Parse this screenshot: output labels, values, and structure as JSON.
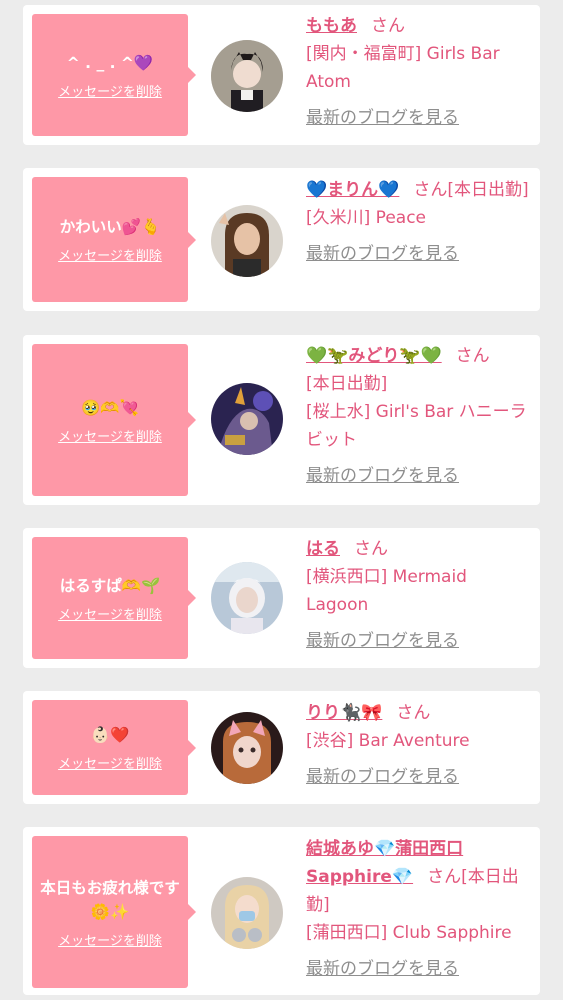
{
  "entries": [
    {
      "message": "^ . _ . ^💜",
      "delete_label": "メッセージを削除",
      "name": "ももあ",
      "honorific": "さん",
      "status": "",
      "shop": "[関内・福富町] Girls Bar Atom",
      "blog_link": "最新のブログを見る",
      "avatar": "avatar-photo-catgirl"
    },
    {
      "message": "かわいい💕🫰",
      "delete_label": "メッセージを削除",
      "name": "💙まりん💙",
      "honorific": "さん",
      "status": "[本日出勤]",
      "shop": "[久米川] Peace",
      "blog_link": "最新のブログを見る",
      "avatar": "avatar-photo-peace-sign"
    },
    {
      "message": "🥹🫶💘",
      "delete_label": "メッセージを削除",
      "name": "💚🦖みどり🦖💚",
      "honorific": "さん",
      "status": "[本日出勤]",
      "shop": "[桜上水] Girl's Bar ハニーラビット",
      "blog_link": "最新のブログを見る",
      "avatar": "avatar-photo-cosplay"
    },
    {
      "message": "はるすぱ🫶🌱",
      "delete_label": "メッセージを削除",
      "name": "はる",
      "honorific": "さん",
      "status": "",
      "shop": "[横浜西口] Mermaid Lagoon",
      "blog_link": "最新のブログを見る",
      "avatar": "avatar-photo-maid"
    },
    {
      "message": "👶🏻❤️",
      "delete_label": "メッセージを削除",
      "name": "りり🐈‍⬛🎀",
      "honorific": "さん",
      "status": "",
      "shop": "[渋谷] Bar Aventure",
      "blog_link": "最新のブログを見る",
      "avatar": "avatar-photo-cat-ears-filter"
    },
    {
      "message": "本日もお疲れ様です🌼✨",
      "delete_label": "メッセージを削除",
      "name": "結城あゆ💎蒲田西口Sapphire💎",
      "honorific": "さん",
      "status": "[本日出勤]",
      "shop": "[蒲田西口] Club Sapphire",
      "blog_link": "最新のブログを見る",
      "avatar": "avatar-photo-masked"
    }
  ]
}
